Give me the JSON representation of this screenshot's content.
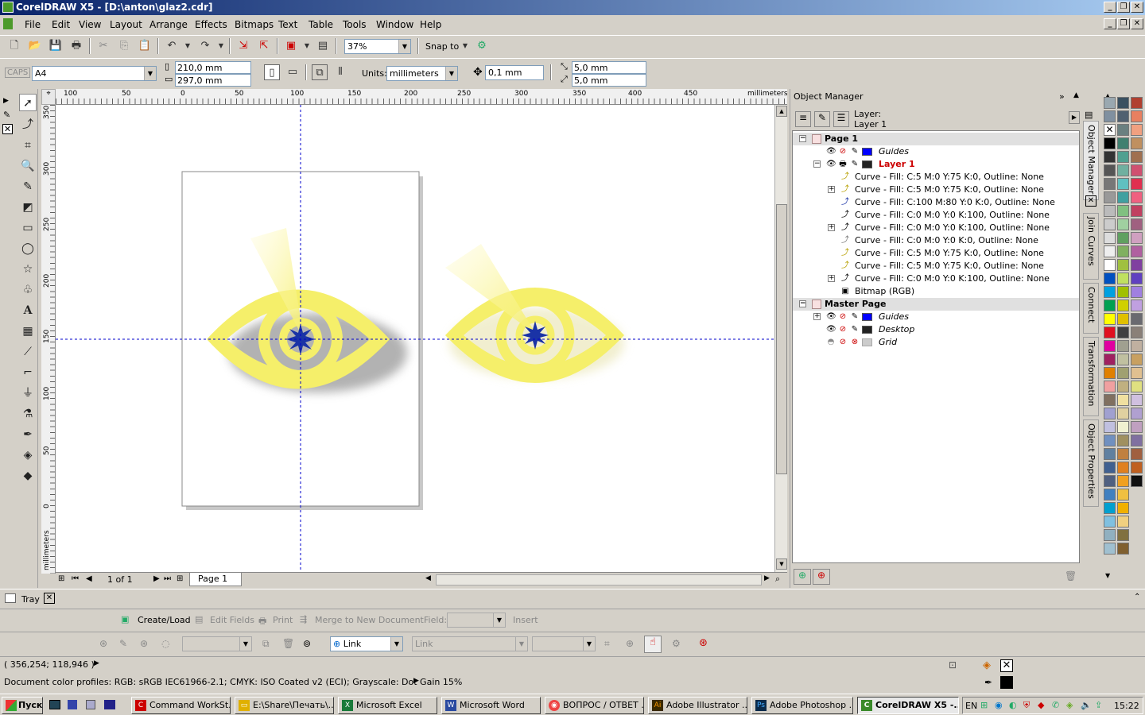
{
  "window": {
    "title": "CorelDRAW X5 - [D:\\anton\\glaz2.cdr]"
  },
  "menu": [
    "File",
    "Edit",
    "View",
    "Layout",
    "Arrange",
    "Effects",
    "Bitmaps",
    "Text",
    "Table",
    "Tools",
    "Window",
    "Help"
  ],
  "toolbar": {
    "zoom": "37%",
    "snap_to": "Snap to"
  },
  "property_bar": {
    "caps": "CAPS",
    "paper": "A4",
    "width": "210,0 mm",
    "height": "297,0 mm",
    "units_label": "Units:",
    "units": "millimeters",
    "nudge": "0,1 mm",
    "dup_x": "5,0 mm",
    "dup_y": "5,0 mm"
  },
  "rulers": {
    "unit": "millimeters",
    "top_ticks": [
      "100",
      "50",
      "0",
      "50",
      "100",
      "150",
      "200",
      "250",
      "300",
      "350",
      "400",
      "450"
    ],
    "left_ticks": [
      "350",
      "300",
      "250",
      "200",
      "150",
      "100",
      "50",
      "0"
    ],
    "left_unit": "millimeters"
  },
  "page_nav": {
    "counter": "1 of 1",
    "tab": "Page 1"
  },
  "object_manager": {
    "title": "Object Manager",
    "layer_label": "Layer:",
    "layer_name": "Layer 1",
    "page1": "Page 1",
    "guides": "Guides",
    "layer1": "Layer 1",
    "objects": [
      "Curve - Fill: C:5 M:0 Y:75 K:0, Outline: None",
      "Curve - Fill: C:5 M:0 Y:75 K:0, Outline: None",
      "Curve - Fill: C:100 M:80 Y:0 K:0, Outline: None",
      "Curve - Fill: C:0 M:0 Y:0 K:100, Outline: None",
      "Curve - Fill: C:0 M:0 Y:0 K:100, Outline: None",
      "Curve - Fill: C:0 M:0 Y:0 K:0, Outline: None",
      "Curve - Fill: C:5 M:0 Y:75 K:0, Outline: None",
      "Curve - Fill: C:5 M:0 Y:75 K:0, Outline: None",
      "Curve - Fill: C:0 M:0 Y:0 K:100, Outline: None",
      "Bitmap (RGB)"
    ],
    "master_page": "Master Page",
    "master_guides": "Guides",
    "desktop": "Desktop",
    "grid": "Grid"
  },
  "dock_tabs": [
    "Object Manager",
    "Join Curves",
    "Connect",
    "Transformation",
    "Object Properties"
  ],
  "tray": {
    "label": "Tray"
  },
  "merge_bar": {
    "create_load": "Create/Load",
    "edit_fields": "Edit Fields",
    "print": "Print",
    "merge": "Merge to New Document",
    "field": "Field:",
    "insert": "Insert"
  },
  "link_bar": {
    "link_button": "Link",
    "link_combo": "Link"
  },
  "status": {
    "coords": "( 356,254; 118,946 )",
    "profiles": "Document color profiles: RGB: sRGB IEC61966-2.1; CMYK: ISO Coated v2 (ECI); Grayscale: Dot Gain 15%"
  },
  "taskbar": {
    "start": "Пуск",
    "tasks": [
      "Command WorkSt...",
      "E:\\Share\\Печать\\...",
      "Microsoft Excel",
      "Microsoft Word",
      "ВОПРОС / ОТВЕТ ...",
      "Adobe Illustrator ...",
      "Adobe Photoshop ...",
      "CorelDRAW X5 -..."
    ],
    "lang": "EN",
    "clock": "15:22"
  },
  "colors": {
    "guide_blue": "#0000cc",
    "eye_yellow": "#f5ef6a",
    "pupil_blue": "#1a33a6",
    "layer_red": "#cc0000"
  }
}
